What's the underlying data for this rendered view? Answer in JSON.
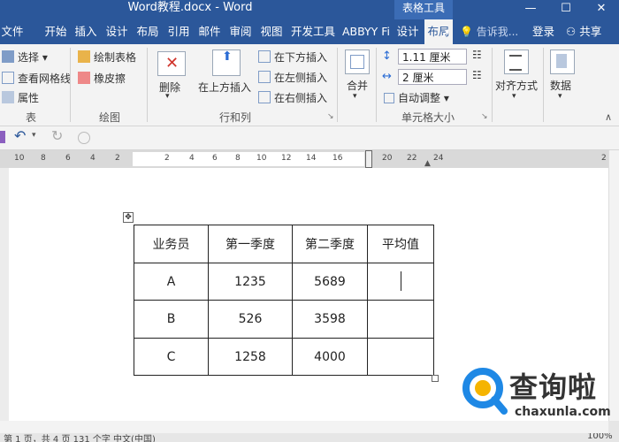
{
  "window": {
    "title": "Word教程.docx - Word",
    "context_group": "表格工具",
    "controls": [
      "—",
      "☐",
      "✕"
    ]
  },
  "tabs": [
    "文件",
    "开始",
    "插入",
    "设计",
    "布局",
    "引用",
    "邮件",
    "审阅",
    "视图",
    "开发工具",
    "ABBYY Fi",
    "设计",
    "布局"
  ],
  "active_tab_index": 12,
  "tell_me": "告诉我...",
  "login": "登录",
  "share": "共享",
  "ribbon": {
    "select": "选择",
    "view_gridlines": "查看网格线",
    "properties": "属性",
    "group_table": "表",
    "draw_table": "绘制表格",
    "eraser": "橡皮擦",
    "group_draw": "绘图",
    "delete": "删除",
    "insert_above": "在上方插入",
    "insert_below": "在下方插入",
    "insert_left": "在左侧插入",
    "insert_right": "在右侧插入",
    "group_rows_cols": "行和列",
    "merge": "合并",
    "height_value": "1.11 厘米",
    "width_value": "2 厘米",
    "autofit": "自动调整",
    "group_cell_size": "单元格大小",
    "alignment": "对齐方式",
    "data": "数据"
  },
  "ruler_numbers": [
    "10",
    "8",
    "6",
    "4",
    "2",
    "2",
    "4",
    "6",
    "8",
    "10",
    "12",
    "14",
    "16",
    "20",
    "22",
    "24",
    "2"
  ],
  "table": {
    "headers": [
      "业务员",
      "第一季度",
      "第二季度",
      "平均值"
    ],
    "rows": [
      [
        "A",
        "1235",
        "5689",
        ""
      ],
      [
        "B",
        "526",
        "3598",
        ""
      ],
      [
        "C",
        "1258",
        "4000",
        ""
      ]
    ]
  },
  "status": {
    "text": "第 1 页，共 4 页    131 个字    中文(中国)",
    "zoom": "100%"
  },
  "watermark": {
    "brand": "查询啦",
    "url": "chaxunla.com"
  },
  "colors": {
    "brand_blue": "#2b579a",
    "ribbon_bg": "#f3f3f3",
    "watermark_blue": "#1e88e5"
  }
}
